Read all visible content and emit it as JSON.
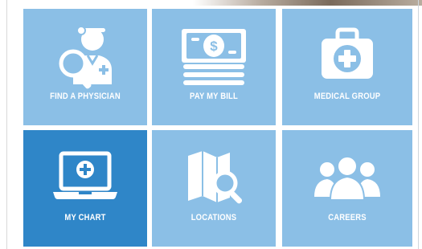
{
  "colors": {
    "tile": "#8bbfe6",
    "tile_active": "#2f86c8",
    "icon": "#ffffff"
  },
  "tiles": [
    {
      "label": "FIND A PHYSICIAN",
      "icon": "physician-search-icon",
      "active": false
    },
    {
      "label": "PAY MY BILL",
      "icon": "cash-bill-icon",
      "active": false
    },
    {
      "label": "MEDICAL GROUP",
      "icon": "medical-kit-icon",
      "active": false
    },
    {
      "label": "MY CHART",
      "icon": "laptop-medical-icon",
      "active": true
    },
    {
      "label": "LOCATIONS",
      "icon": "map-search-icon",
      "active": false
    },
    {
      "label": "CAREERS",
      "icon": "people-group-icon",
      "active": false
    }
  ]
}
